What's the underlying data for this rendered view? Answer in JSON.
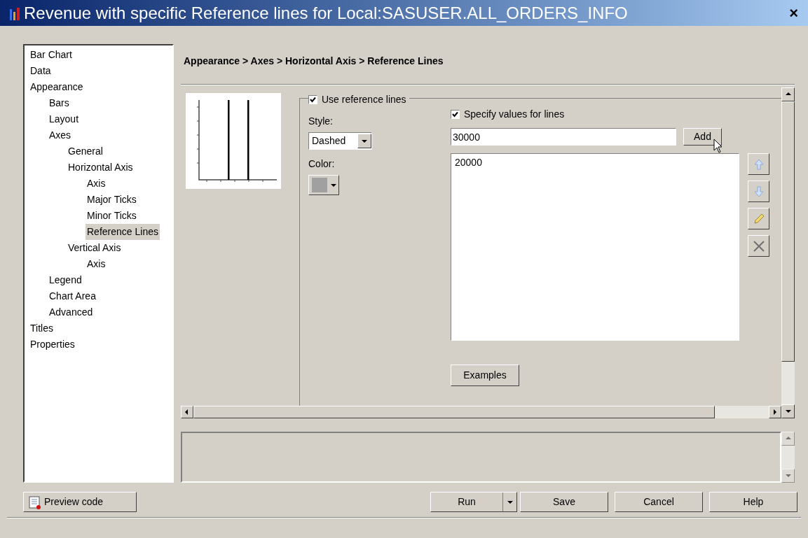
{
  "window": {
    "title": "Revenue with specific Reference lines for Local:SASUSER.ALL_ORDERS_INFO",
    "close": "×"
  },
  "tree": [
    {
      "label": "Bar Chart",
      "selected": false
    },
    {
      "label": "Data",
      "selected": false
    },
    {
      "label": "Appearance",
      "selected": false,
      "children": [
        {
          "label": "Bars",
          "selected": false
        },
        {
          "label": "Layout",
          "selected": false
        },
        {
          "label": "Axes",
          "selected": false,
          "children": [
            {
              "label": "General",
              "selected": false
            },
            {
              "label": "Horizontal Axis",
              "selected": false,
              "children": [
                {
                  "label": "Axis",
                  "selected": false
                },
                {
                  "label": "Major Ticks",
                  "selected": false
                },
                {
                  "label": "Minor Ticks",
                  "selected": false
                },
                {
                  "label": "Reference Lines",
                  "selected": true
                }
              ]
            },
            {
              "label": "Vertical Axis",
              "selected": false,
              "children": [
                {
                  "label": "Axis",
                  "selected": false
                }
              ]
            }
          ]
        },
        {
          "label": "Legend",
          "selected": false
        },
        {
          "label": "Chart Area",
          "selected": false
        },
        {
          "label": "Advanced",
          "selected": false
        }
      ]
    },
    {
      "label": "Titles",
      "selected": false
    },
    {
      "label": "Properties",
      "selected": false
    }
  ],
  "breadcrumb": "Appearance > Axes > Horizontal Axis > Reference Lines",
  "reference_lines": {
    "use_label": "Use reference lines",
    "use_checked": true,
    "style_label": "Style:",
    "style_value": "Dashed",
    "color_label": "Color:",
    "specify_label": "Specify values for lines",
    "specify_checked": true,
    "value_input": "30000",
    "add_button": "Add",
    "values": [
      "20000"
    ],
    "examples_button": "Examples"
  },
  "buttons": {
    "preview_code": "Preview code",
    "run": "Run",
    "save": "Save",
    "cancel": "Cancel",
    "help": "Help"
  }
}
